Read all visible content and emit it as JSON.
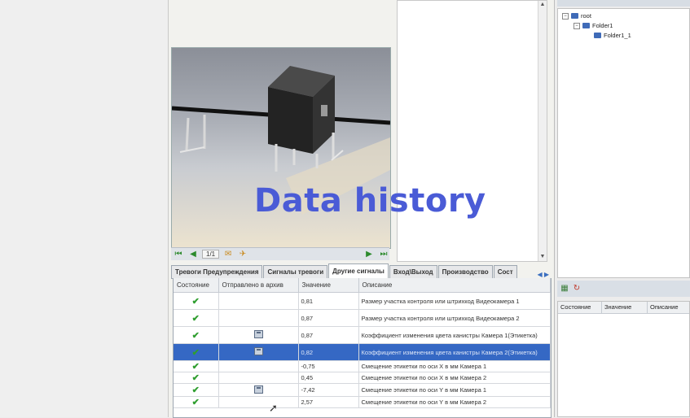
{
  "overlay_title": "Data history",
  "viewer": {
    "page_counter": "1/1"
  },
  "tabs": [
    {
      "label": "Тревоги Предупреждения",
      "active": false
    },
    {
      "label": "Сигналы тревоги",
      "active": false
    },
    {
      "label": "Другие сигналы",
      "active": true
    },
    {
      "label": "Вход\\Выход",
      "active": false
    },
    {
      "label": "Производство",
      "active": false
    },
    {
      "label": "Сост",
      "active": false
    }
  ],
  "table": {
    "columns": [
      "Состояние",
      "Отправлено в архив",
      "Значение",
      "Описание"
    ],
    "rows": [
      {
        "status_icon": "check-icon",
        "archived": false,
        "value": "0,81",
        "description": "Размер участка контроля или штрихкод Видеокамера 1",
        "selected": false
      },
      {
        "status_icon": "check-icon",
        "archived": false,
        "value": "0,87",
        "description": "Размер участка контроля или штрихкод Видеокамера 2",
        "selected": false
      },
      {
        "status_icon": "check-icon",
        "archived": true,
        "value": "0,87",
        "description": "Коэффициент изменения цвета канистры Камера 1(Этикетка)",
        "selected": false
      },
      {
        "status_icon": "check-icon",
        "archived": true,
        "value": "0,82",
        "description": "Коэффициент изменения цвета канистры Камера 2(Этикетка)",
        "selected": true
      },
      {
        "status_icon": "check-icon",
        "archived": false,
        "value": "-0,75",
        "description": "Смещение этикетки по оси X в мм Камера 1",
        "selected": false
      },
      {
        "status_icon": "check-icon",
        "archived": false,
        "value": "0,45",
        "description": "Смещение этикетки по оси X в мм Камера 2",
        "selected": false
      },
      {
        "status_icon": "check-icon",
        "archived": true,
        "value": "-7,42",
        "description": "Смещение этикетки по оси Y в мм Камера 1",
        "selected": false
      },
      {
        "status_icon": "check-icon",
        "archived": false,
        "value": "2,57",
        "description": "Смещение этикетки по оси Y в мм Камера 2",
        "selected": false
      }
    ]
  },
  "tree": {
    "root": "root",
    "folder1": "Folder1",
    "folder1_1": "Folder1_1"
  },
  "right_grid": {
    "columns": [
      "Состояние",
      "Значение",
      "Описание"
    ]
  },
  "colors": {
    "title": "#4a5bd6",
    "selection": "#3568c4",
    "check": "#2f9e2f"
  }
}
